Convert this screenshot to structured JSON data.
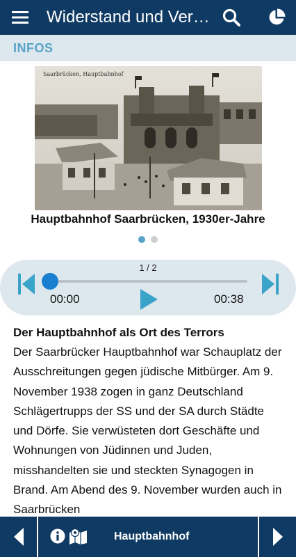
{
  "appbar": {
    "title": "Widerstand und Verfolgung",
    "menu_icon": "hamburger-menu-icon",
    "search_icon": "search-icon",
    "stats_icon": "pie-chart-icon"
  },
  "section": {
    "label": "INFOS"
  },
  "gallery": {
    "photo_caption": "Hauptbahnhof Saarbrücken, 1930er-Jahre",
    "photo_inscription": "Saarbrücken, Hauptbahnhof",
    "pages_total": 2,
    "current_page": 1
  },
  "player": {
    "counter": "1 / 2",
    "time_elapsed": "00:00",
    "time_total": "00:38",
    "progress": 0.0,
    "accent_color": "#1a93c9"
  },
  "article": {
    "heading": "Der Hauptbahnhof als Ort des Terrors",
    "body": "Der Saarbrücker Hauptbahnhof war Schauplatz der Ausschreitungen gegen jüdische Mitbürger. Am 9. November 1938 zogen in ganz Deutschland Schlägertrupps der SS und der SA durch Städte und Dörfe. Sie verwüsteten dort Geschäfte und Wohnungen von Jüdinnen und Juden, misshandelten sie und steckten Synagogen in Brand. Am Abend des 9. November wurden auch in Saarbrücken"
  },
  "bottombar": {
    "title": "Hauptbahnhof",
    "back_icon": "chevron-left-icon",
    "forward_icon": "chevron-right-icon",
    "info_icon": "info-icon",
    "map_icon": "map-marker-icon"
  },
  "colors": {
    "primary": "#0f3a63",
    "section_bg": "#dde7ee",
    "accent": "#5aa3c8"
  }
}
